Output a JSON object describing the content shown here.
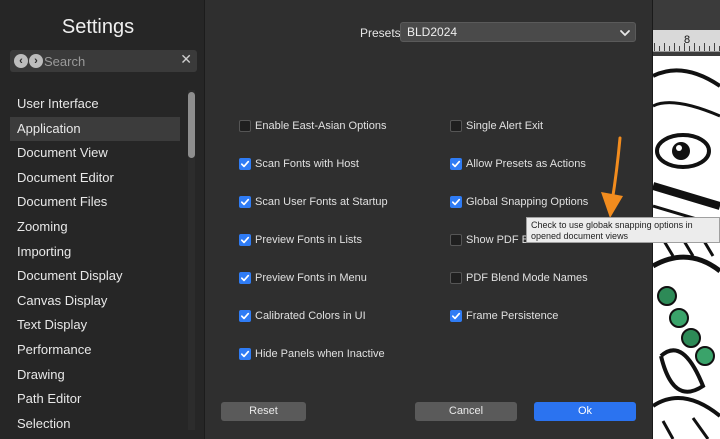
{
  "sidebar": {
    "title": "Settings",
    "search_placeholder": "Search",
    "items": [
      {
        "label": "User Interface",
        "selected": false
      },
      {
        "label": "Application",
        "selected": true
      },
      {
        "label": "Document View",
        "selected": false
      },
      {
        "label": "Document Editor",
        "selected": false
      },
      {
        "label": "Document Files",
        "selected": false
      },
      {
        "label": "Zooming",
        "selected": false
      },
      {
        "label": "Importing",
        "selected": false
      },
      {
        "label": "Document Display",
        "selected": false
      },
      {
        "label": "Canvas Display",
        "selected": false
      },
      {
        "label": "Text Display",
        "selected": false
      },
      {
        "label": "Performance",
        "selected": false
      },
      {
        "label": "Drawing",
        "selected": false
      },
      {
        "label": "Path Editor",
        "selected": false
      },
      {
        "label": "Selection",
        "selected": false
      }
    ]
  },
  "presets": {
    "label": "Presets",
    "value": "BLD2024"
  },
  "options": {
    "left": [
      {
        "label": "Enable East-Asian Options",
        "checked": false
      },
      {
        "label": "Scan Fonts with Host",
        "checked": true
      },
      {
        "label": "Scan User Fonts at Startup",
        "checked": true
      },
      {
        "label": "Preview Fonts in Lists",
        "checked": true
      },
      {
        "label": "Preview Fonts in Menu",
        "checked": true
      },
      {
        "label": "Calibrated Colors in UI",
        "checked": true
      },
      {
        "label": "Hide Panels when Inactive",
        "checked": true
      }
    ],
    "right": [
      {
        "label": "Single Alert Exit",
        "checked": false
      },
      {
        "label": "Allow Presets as Actions",
        "checked": true
      },
      {
        "label": "Global Snapping Options",
        "checked": true
      },
      {
        "label": "Show PDF Bl",
        "checked": false
      },
      {
        "label": "PDF Blend Mode Names",
        "checked": false
      },
      {
        "label": "Frame Persistence",
        "checked": true
      }
    ]
  },
  "tooltip": "Check to use globak snapping options in opened document views",
  "buttons": {
    "reset": "Reset",
    "cancel": "Cancel",
    "ok": "Ok"
  },
  "background_app": {
    "ruler_label": "8"
  },
  "colors": {
    "accent": "#2f7cf5",
    "arrow": "#f28c1e",
    "dialog_bg": "#2f2f2f",
    "sidebar_bg": "#262626"
  }
}
